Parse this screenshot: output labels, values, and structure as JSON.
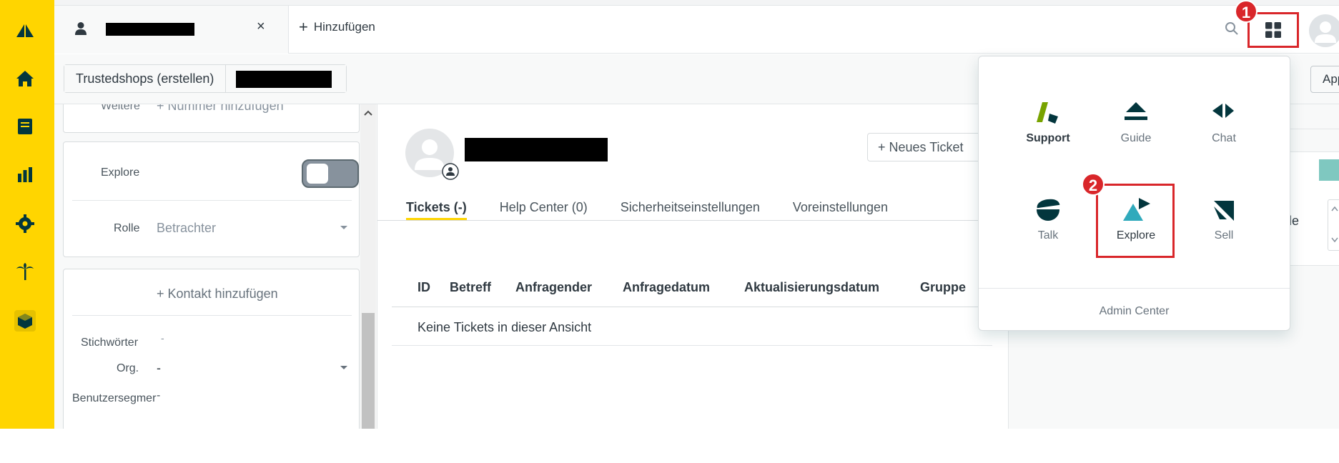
{
  "topbar": {
    "add_label": "Hinzufügen",
    "close_symbol": "×"
  },
  "subbar": {
    "breadcrumb_org": "Trustedshops (erstellen)",
    "app_button": "Apps"
  },
  "left_panel": {
    "weitere_label": "Weitere",
    "add_number": "+ Nummer hinzufügen",
    "explore_label": "Explore",
    "rolle_label": "Rolle",
    "rolle_value": "Betrachter",
    "add_contact": "+ Kontakt hinzufügen",
    "tags_label": "Stichwörter",
    "tags_value": "-",
    "org_label": "Org.",
    "org_value": "-",
    "segment_label": "Benutzersegmer",
    "segment_value": "-"
  },
  "main": {
    "new_ticket": "+ Neues Ticket",
    "tabs": [
      "Tickets (-)",
      "Help Center (0)",
      "Sicherheitseinstellungen",
      "Voreinstellungen"
    ],
    "columns": [
      "ID",
      "Betreff",
      "Anfragender",
      "Anfragedatum",
      "Aktualisierungsdatum",
      "Gruppe"
    ],
    "empty_text": "Keine Tickets in dieser Ansicht"
  },
  "right_panel": {
    "partial_text": "able"
  },
  "product_menu": {
    "items": [
      "Support",
      "Guide",
      "Chat",
      "Talk",
      "Explore",
      "Sell"
    ],
    "admin_center": "Admin Center"
  },
  "annotations": {
    "badge_1": "1",
    "badge_2": "2",
    "highlight_color": "#d9262a"
  },
  "colors": {
    "nav_yellow": "#ffd500",
    "dark_teal": "#03363d",
    "support_green": "#78a300",
    "explore_blue": "#30aabc"
  }
}
